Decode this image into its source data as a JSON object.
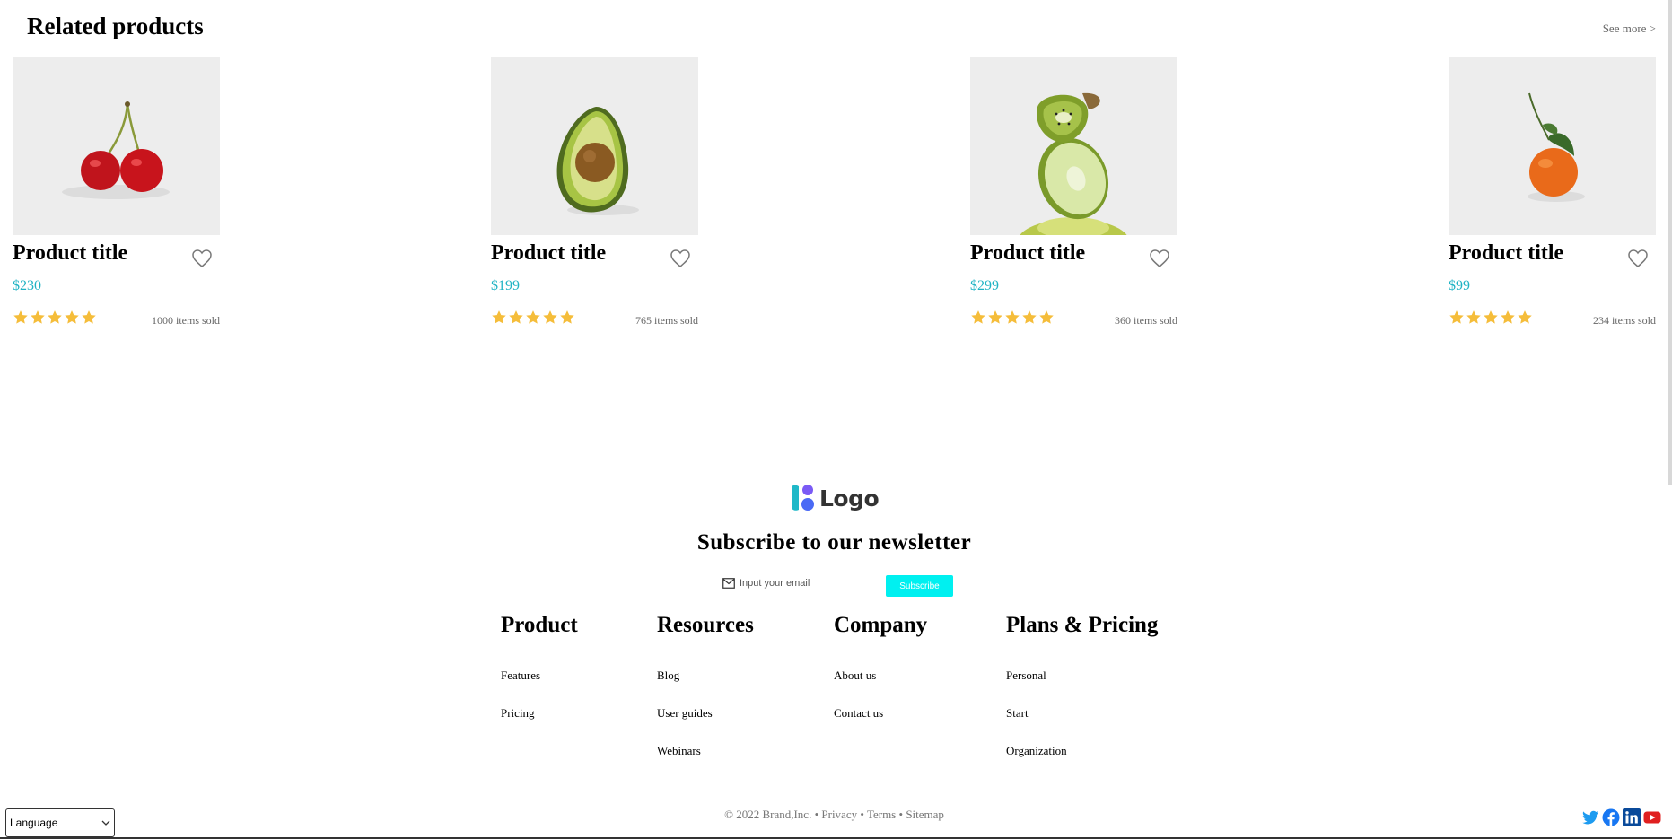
{
  "related": {
    "title": "Related products",
    "see_more": "See more >"
  },
  "products": [
    {
      "title": "Product title",
      "price": "$230",
      "sold": "1000 items sold",
      "rating": 5,
      "image": "cherry"
    },
    {
      "title": "Product title",
      "price": "$199",
      "sold": "765 items sold",
      "rating": 5,
      "image": "avocado"
    },
    {
      "title": "Product title",
      "price": "$299",
      "sold": "360 items sold",
      "rating": 5,
      "image": "kiwi-lime"
    },
    {
      "title": "Product title",
      "price": "$99",
      "sold": "234 items sold",
      "rating": 5,
      "image": "tangerine"
    }
  ],
  "footer": {
    "logo_text": "Logo",
    "newsletter_title": "Subscribe to our newsletter",
    "email_placeholder": "Input your email",
    "subscribe_label": "Subscribe",
    "columns": [
      {
        "title": "Product",
        "links": [
          "Features",
          "Pricing"
        ]
      },
      {
        "title": "Resources",
        "links": [
          "Blog",
          "User guides",
          "Webinars"
        ]
      },
      {
        "title": "Company",
        "links": [
          "About us",
          "Contact us"
        ]
      },
      {
        "title": "Plans & Pricing",
        "links": [
          "Personal",
          "Start",
          "Organization"
        ]
      }
    ],
    "copyright": "© 2022 Brand,Inc.",
    "separator": "•",
    "privacy": "Privacy",
    "terms": "Terms",
    "sitemap": "Sitemap",
    "language": "Language",
    "social": [
      "twitter-icon",
      "facebook-icon",
      "linkedin-icon",
      "youtube-icon"
    ]
  },
  "colors": {
    "price": "#1fb3c4",
    "star": "#f5bd3a",
    "subscribe": "#00f0f0",
    "logo_teal": "#1fb8c8",
    "logo_purple": "#7a5af5"
  }
}
